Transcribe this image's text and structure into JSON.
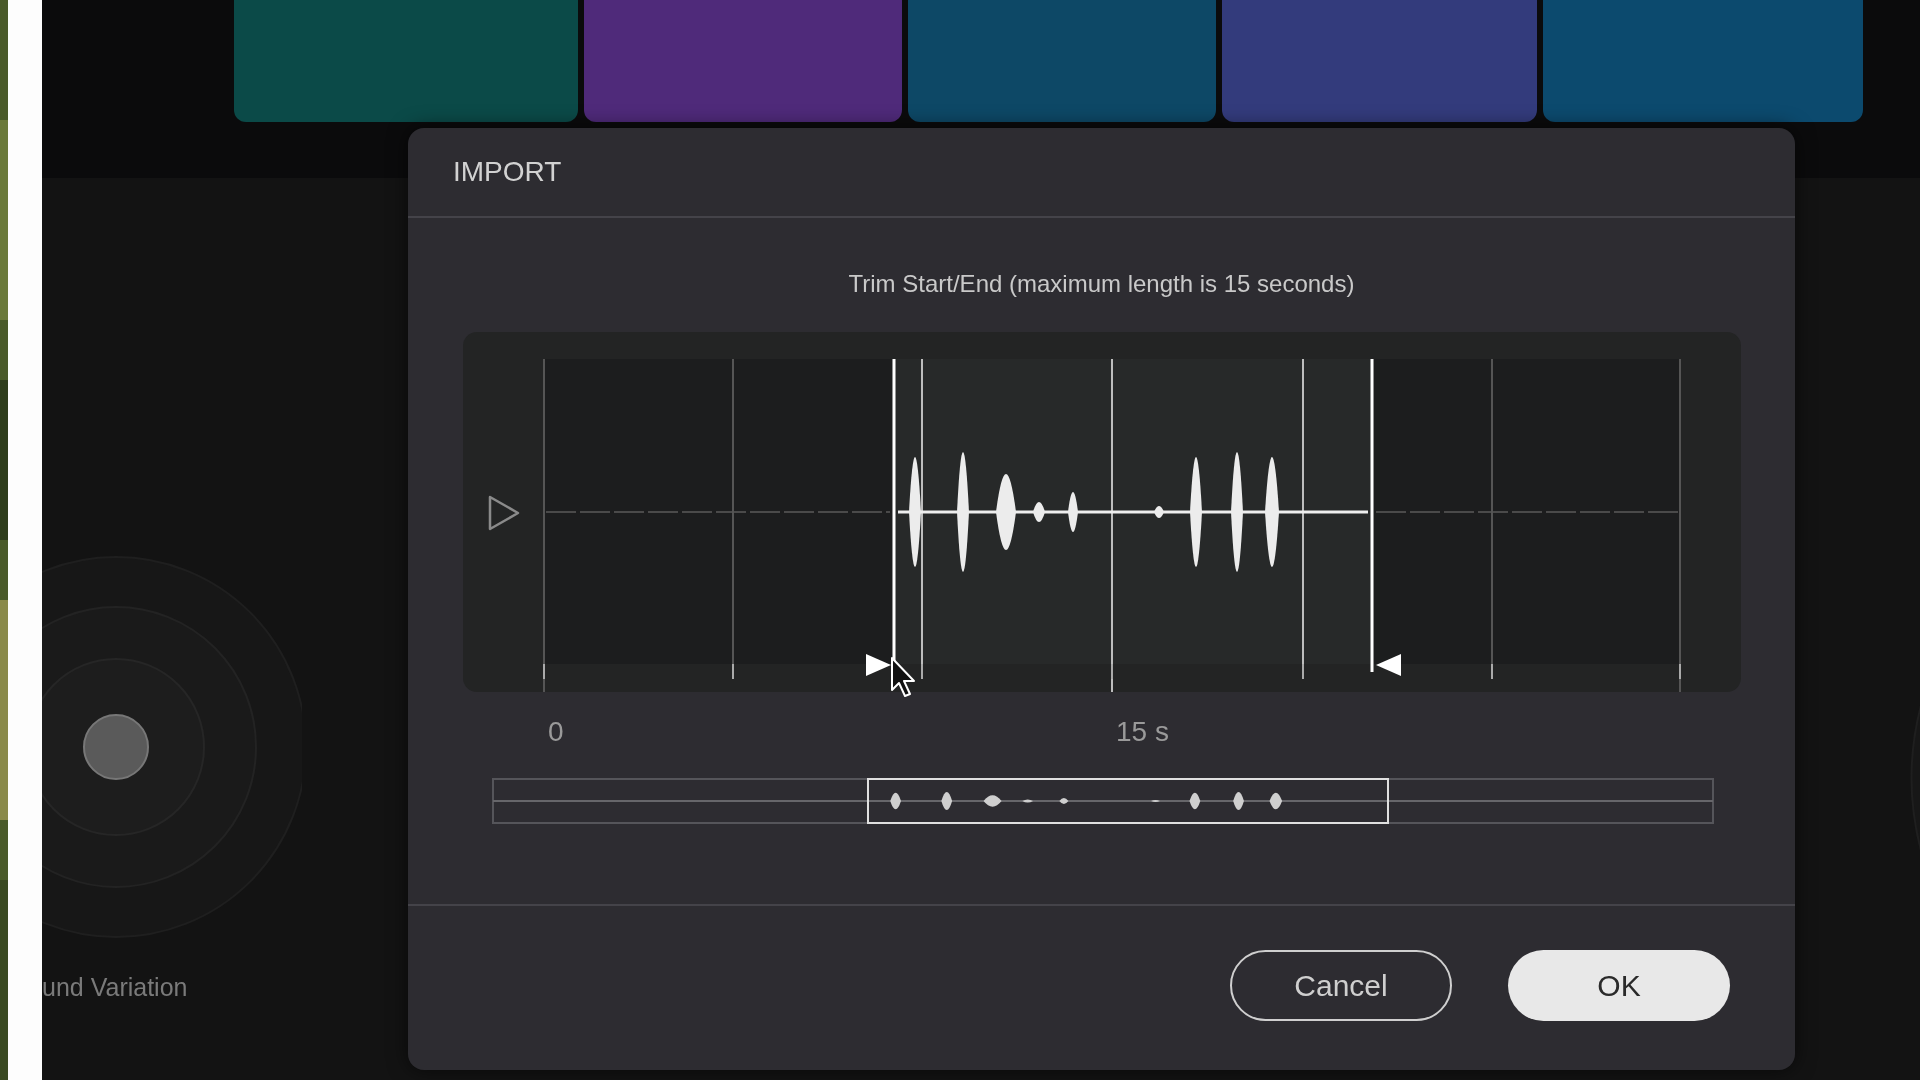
{
  "pads": [
    {
      "color": "#0b4a48"
    },
    {
      "color": "#4f2a7a"
    },
    {
      "color": "#0d4866"
    },
    {
      "color": "#333b7c"
    },
    {
      "color": "#0c4a6e"
    }
  ],
  "knob": {
    "label": "und Variation"
  },
  "dialog": {
    "title": "IMPORT",
    "instruction": "Trim Start/End (maximum length is 15 seconds)",
    "axis_labels": [
      "0",
      "15 s"
    ],
    "buttons": [
      {
        "label": "Cancel",
        "kind": "secondary"
      },
      {
        "label": "OK",
        "kind": "primary"
      }
    ]
  }
}
